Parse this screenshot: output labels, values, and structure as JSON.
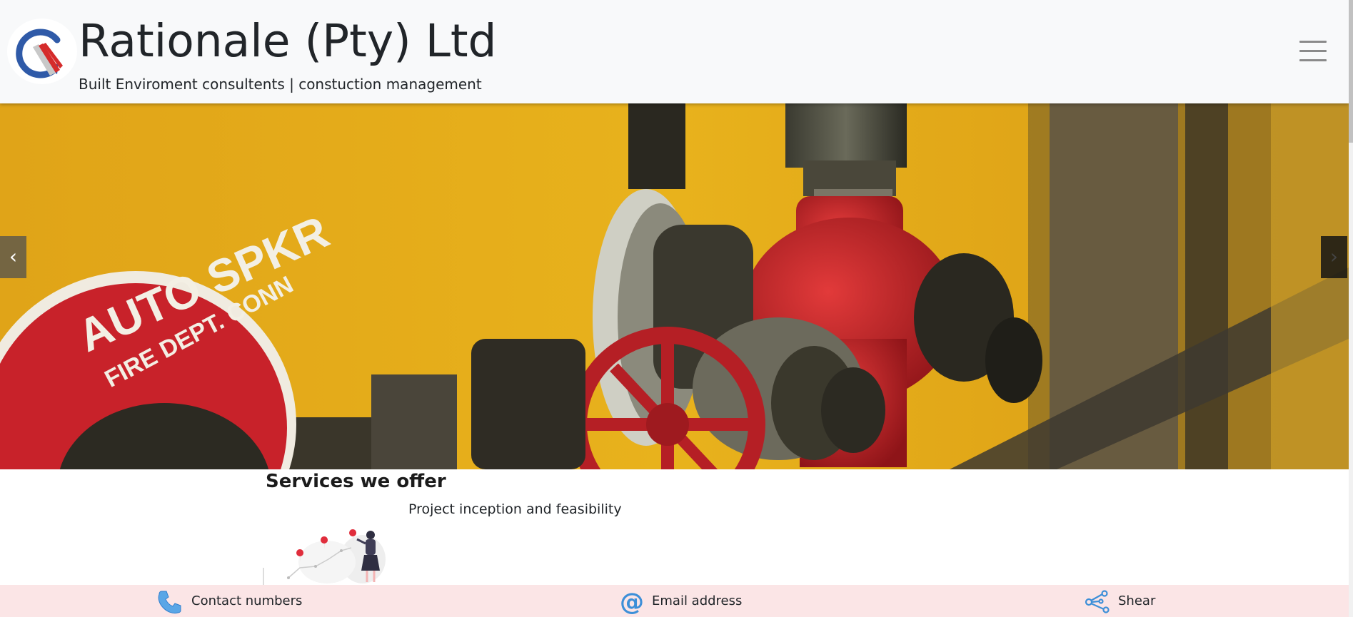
{
  "header": {
    "brand_title": "Rationale (Pty) Ltd",
    "brand_subtitle": "Built Enviroment consultents | constuction management",
    "logo_icon": "rationale-logo-icon",
    "menu_icon": "hamburger-menu-icon"
  },
  "carousel": {
    "prev_label": "‹",
    "next_label": "›",
    "image_text": {
      "line1": "AUTO SPKR",
      "line2": "FIRE DEPT. CONN"
    }
  },
  "services": {
    "title": "Services we offer",
    "items": [
      {
        "label": "Project inception and feasibility"
      }
    ]
  },
  "footer": {
    "contact_label": "Contact numbers",
    "email_label": "Email address",
    "share_label": "Shear",
    "icons": [
      "phone-icon",
      "at-sign-icon",
      "share-icon"
    ]
  },
  "colors": {
    "navbar_bg": "#f8f9fa",
    "footer_bg": "#fbe5e6",
    "icon_blue": "#3d8fd8",
    "logo_blue": "#2f5aa8",
    "logo_red": "#d52b2b",
    "wall_yellow": "#e3a817",
    "pipe_red": "#c8222a"
  }
}
